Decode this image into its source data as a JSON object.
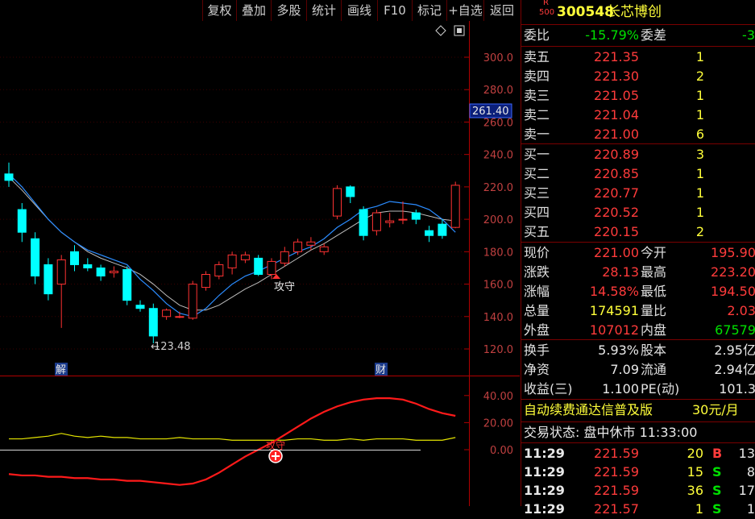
{
  "toolbar": {
    "buttons": [
      "复权",
      "叠加",
      "多股",
      "统计",
      "画线",
      "F10",
      "标记",
      "+自选",
      "返回"
    ]
  },
  "chart": {
    "price_axis": [
      "300.0",
      "280.0",
      "260.0",
      "240.0",
      "220.0",
      "200.0",
      "180.0",
      "160.0",
      "140.0",
      "120.0"
    ],
    "current_price_tag": "261.40",
    "low_marker": "123.48",
    "signal_label_main": "攻守",
    "event_markers": [
      "解",
      "财"
    ],
    "sub_axis": [
      "40.00",
      "20.00",
      "0.00"
    ],
    "signal_label_sub": "攻守",
    "colors": {
      "up": "#ff3232",
      "down": "#00ffff",
      "ma_short": "#2b8cff",
      "ma_long": "#bdbdbd",
      "sub_red": "#ff1a1a",
      "sub_yellow": "#e6e600",
      "axis": "#b00000"
    }
  },
  "chart_data": {
    "type": "candlestick",
    "ylim": [
      110,
      310
    ],
    "candles": [
      {
        "o": 228,
        "c": 224,
        "h": 235,
        "l": 220
      },
      {
        "o": 206,
        "c": 192,
        "h": 210,
        "l": 186
      },
      {
        "o": 188,
        "c": 165,
        "h": 192,
        "l": 160
      },
      {
        "o": 172,
        "c": 154,
        "h": 176,
        "l": 150
      },
      {
        "o": 160,
        "c": 175,
        "h": 178,
        "l": 133
      },
      {
        "o": 180,
        "c": 172,
        "h": 184,
        "l": 168
      },
      {
        "o": 172,
        "c": 170,
        "h": 176,
        "l": 168
      },
      {
        "o": 170,
        "c": 165,
        "h": 172,
        "l": 162
      },
      {
        "o": 167,
        "c": 168,
        "h": 171,
        "l": 164
      },
      {
        "o": 169,
        "c": 150,
        "h": 171,
        "l": 147
      },
      {
        "o": 147,
        "c": 145,
        "h": 150,
        "l": 143
      },
      {
        "o": 145,
        "c": 128,
        "h": 148,
        "l": 123.48
      },
      {
        "o": 140,
        "c": 144,
        "h": 145,
        "l": 138
      },
      {
        "o": 140,
        "c": 140,
        "h": 143,
        "l": 139
      },
      {
        "o": 139,
        "c": 160,
        "h": 162,
        "l": 138
      },
      {
        "o": 158,
        "c": 166,
        "h": 168,
        "l": 156
      },
      {
        "o": 165,
        "c": 172,
        "h": 174,
        "l": 163
      },
      {
        "o": 170,
        "c": 178,
        "h": 180,
        "l": 166
      },
      {
        "o": 175,
        "c": 178,
        "h": 180,
        "l": 173
      },
      {
        "o": 176,
        "c": 166,
        "h": 178,
        "l": 165
      },
      {
        "o": 166,
        "c": 174,
        "h": 176,
        "l": 163
      },
      {
        "o": 173,
        "c": 180,
        "h": 183,
        "l": 171
      },
      {
        "o": 180,
        "c": 186,
        "h": 188,
        "l": 178
      },
      {
        "o": 184,
        "c": 186,
        "h": 189,
        "l": 181
      },
      {
        "o": 180,
        "c": 183,
        "h": 185,
        "l": 178
      },
      {
        "o": 202,
        "c": 219,
        "h": 221,
        "l": 200
      },
      {
        "o": 220,
        "c": 214,
        "h": 221,
        "l": 210
      },
      {
        "o": 206,
        "c": 190,
        "h": 208,
        "l": 187
      },
      {
        "o": 193,
        "c": 204,
        "h": 206,
        "l": 190
      },
      {
        "o": 198,
        "c": 199,
        "h": 204,
        "l": 195
      },
      {
        "o": 200,
        "c": 200,
        "h": 211,
        "l": 197
      },
      {
        "o": 204,
        "c": 200,
        "h": 206,
        "l": 197
      },
      {
        "o": 193,
        "c": 190,
        "h": 196,
        "l": 186
      },
      {
        "o": 197,
        "c": 190,
        "h": 200,
        "l": 188
      },
      {
        "o": 195,
        "c": 221,
        "h": 223.2,
        "l": 194.5
      }
    ],
    "ma_short": [
      228,
      220,
      210,
      200,
      192,
      186,
      181,
      178,
      175,
      172,
      163,
      156,
      148,
      142,
      140,
      145,
      153,
      160,
      165,
      168,
      172,
      176,
      180,
      183,
      188,
      195,
      200,
      206,
      208,
      211,
      210,
      209,
      206,
      200,
      192
    ],
    "ma_long": [
      226,
      218,
      209,
      200,
      192,
      186,
      180,
      176,
      173,
      170,
      166,
      160,
      153,
      147,
      144,
      144,
      147,
      152,
      157,
      161,
      166,
      171,
      176,
      181,
      185,
      190,
      195,
      200,
      204,
      205,
      205,
      204,
      202,
      200,
      199
    ],
    "sub_red": [
      -18,
      -19,
      -19,
      -20,
      -20,
      -21,
      -21,
      -22,
      -22,
      -23,
      -23,
      -24,
      -25,
      -26,
      -25,
      -22,
      -17,
      -11,
      -5,
      0,
      5,
      11,
      17,
      23,
      28,
      32,
      35,
      37,
      38,
      38,
      37,
      34,
      30,
      27,
      25
    ],
    "sub_yellow": [
      8,
      8,
      9,
      10,
      12,
      10,
      9,
      10,
      9,
      9,
      8,
      8,
      8,
      9,
      8,
      8,
      8,
      7,
      7,
      7,
      7,
      7,
      8,
      8,
      7,
      7,
      8,
      7,
      8,
      8,
      8,
      7,
      7,
      7,
      9
    ],
    "sub_ylim": [
      -30,
      48
    ]
  },
  "panel": {
    "stock": {
      "badge_top": "R",
      "badge_bottom": "500",
      "code": "300548",
      "name": "长芯博创"
    },
    "webi": {
      "label": "委比",
      "value": "-15.79%",
      "label2": "委差",
      "value2": "-3"
    },
    "asks": [
      {
        "label": "卖五",
        "price": "221.35",
        "vol": "1"
      },
      {
        "label": "卖四",
        "price": "221.30",
        "vol": "2"
      },
      {
        "label": "卖三",
        "price": "221.05",
        "vol": "1"
      },
      {
        "label": "卖二",
        "price": "221.04",
        "vol": "1"
      },
      {
        "label": "卖一",
        "price": "221.00",
        "vol": "6"
      }
    ],
    "bids": [
      {
        "label": "买一",
        "price": "220.89",
        "vol": "3"
      },
      {
        "label": "买二",
        "price": "220.85",
        "vol": "1"
      },
      {
        "label": "买三",
        "price": "220.77",
        "vol": "1"
      },
      {
        "label": "买四",
        "price": "220.52",
        "vol": "1"
      },
      {
        "label": "买五",
        "price": "220.15",
        "vol": "2"
      }
    ],
    "stats": [
      {
        "l1": "现价",
        "v1": "221.00",
        "l2": "今开",
        "v2": "195.90"
      },
      {
        "l1": "涨跌",
        "v1": "28.13",
        "l2": "最高",
        "v2": "223.20"
      },
      {
        "l1": "涨幅",
        "v1": "14.58%",
        "l2": "最低",
        "v2": "194.50"
      },
      {
        "l1": "总量",
        "v1": "174591",
        "l2": "量比",
        "v2": "2.03"
      },
      {
        "l1": "外盘",
        "v1": "107012",
        "l2": "内盘",
        "v2": "67579"
      }
    ],
    "stats2": [
      {
        "l1": "换手",
        "v1": "5.93%",
        "l2": "股本",
        "v2": "2.95亿"
      },
      {
        "l1": "净资",
        "v1": "7.09",
        "l2": "流通",
        "v2": "2.94亿"
      },
      {
        "l1": "收益(三)",
        "v1": "1.100",
        "l2": "PE(动)",
        "v2": "101.3"
      }
    ],
    "promo": {
      "text": "自动续费通达信普及版",
      "price": "30元/月"
    },
    "status": "交易状态: 盘中休市 11:33:00",
    "ticks": [
      {
        "time": "11:29",
        "price": "221.59",
        "vol": "20",
        "side": "B",
        "num": "13"
      },
      {
        "time": "11:29",
        "price": "221.59",
        "vol": "15",
        "side": "S",
        "num": "8"
      },
      {
        "time": "11:29",
        "price": "221.59",
        "vol": "36",
        "side": "S",
        "num": "17"
      },
      {
        "time": "11:29",
        "price": "221.57",
        "vol": "1",
        "side": "S",
        "num": "1"
      }
    ]
  }
}
